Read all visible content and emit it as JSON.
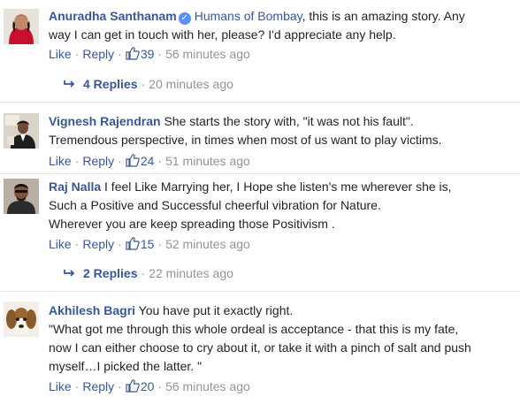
{
  "comments": [
    {
      "author": "Anuradha Santhanam",
      "verified": true,
      "mention": "Humans of Bombay",
      "lines": [
        ", this is an amazing story. Any",
        "way I can get in touch with her, please? I'd appreciate any help."
      ],
      "like_label": "Like",
      "reply_label": "Reply",
      "likes": "39",
      "time": "56 minutes ago",
      "replies_label": "4 Replies",
      "replies_time": "20 minutes ago"
    },
    {
      "author": "Vignesh Rajendran",
      "lines": [
        " She starts the story with, \"it was not his fault\".",
        "Tremendous perspective, in times when most of us want to play victims."
      ],
      "like_label": "Like",
      "reply_label": "Reply",
      "likes": "24",
      "time": "51 minutes ago"
    },
    {
      "author": "Raj Nalla",
      "lines": [
        " I feel Like Marrying her, I Hope she listen's me wherever she is,",
        "Such a Positive and Successful cheerful vibration for Nature.",
        "Wherever you are keep spreading those Positivism ."
      ],
      "like_label": "Like",
      "reply_label": "Reply",
      "likes": "15",
      "time": "52 minutes ago",
      "replies_label": "2 Replies",
      "replies_time": "22 minutes ago"
    },
    {
      "author": "Akhilesh Bagri",
      "lines": [
        " You have put it exactly right.",
        "\"What got me through this whole ordeal is acceptance - that this is my fate,",
        "now I can either choose to cry about it, or take it with a pinch of salt and push",
        "myself…I picked the latter. \""
      ],
      "like_label": "Like",
      "reply_label": "Reply",
      "likes": "20",
      "time": "56 minutes ago"
    }
  ],
  "separator": "·",
  "colors": {
    "link": "#365899",
    "meta": "#90949c",
    "text": "#1d2129",
    "verified": "#5890ff"
  },
  "icons": {
    "like": "thumbs-up-icon",
    "reply_arrow": "reply-arrow-icon",
    "verified": "verified-badge-icon"
  }
}
